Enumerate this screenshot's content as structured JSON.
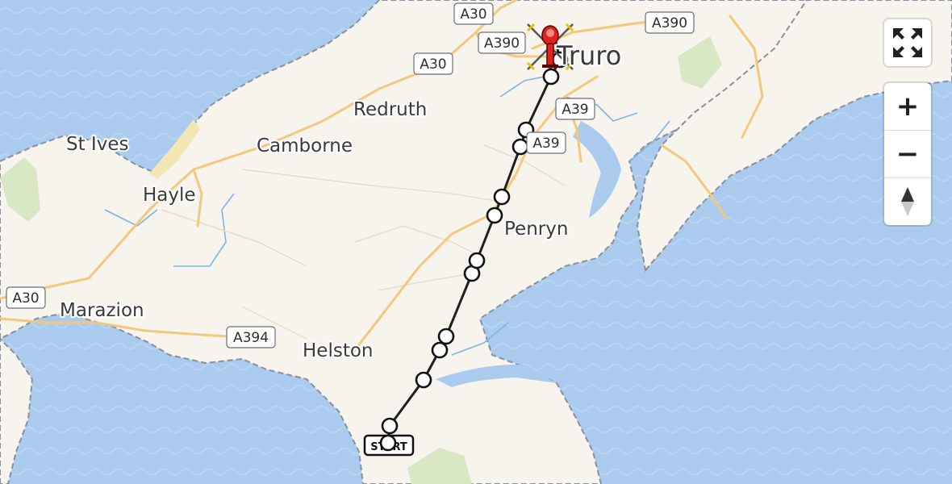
{
  "places": [
    {
      "id": "truro",
      "label": "Truro",
      "size": "large"
    },
    {
      "id": "redruth",
      "label": "Redruth",
      "size": "medium"
    },
    {
      "id": "st-ives",
      "label": "St Ives",
      "size": "medium"
    },
    {
      "id": "camborne",
      "label": "Camborne",
      "size": "medium"
    },
    {
      "id": "hayle",
      "label": "Hayle",
      "size": "medium"
    },
    {
      "id": "penryn",
      "label": "Penryn",
      "size": "medium"
    },
    {
      "id": "marazion",
      "label": "Marazion",
      "size": "medium"
    },
    {
      "id": "helston",
      "label": "Helston",
      "size": "medium"
    }
  ],
  "road_shields": [
    {
      "id": "a30-top",
      "label": "A30"
    },
    {
      "id": "a390-top",
      "label": "A390"
    },
    {
      "id": "a390-right",
      "label": "A390"
    },
    {
      "id": "a30-mid",
      "label": "A30"
    },
    {
      "id": "a39-upper",
      "label": "A39"
    },
    {
      "id": "a39-lower",
      "label": "A39"
    },
    {
      "id": "a30-left",
      "label": "A30"
    },
    {
      "id": "a394",
      "label": "A394"
    }
  ],
  "route": {
    "start_label": "START",
    "waypoint_count": 13,
    "destination_icon": "helicopter-icon"
  },
  "controls": {
    "fullscreen_icon": "fullscreen-icon",
    "zoom_in_label": "+",
    "zoom_out_label": "−",
    "compass_icon": "compass-icon"
  },
  "colors": {
    "water": "#aacbee",
    "land": "#f7f3ed",
    "route": "#1f1f1f",
    "road": "#f2c97c",
    "destination": "#e0211e"
  }
}
